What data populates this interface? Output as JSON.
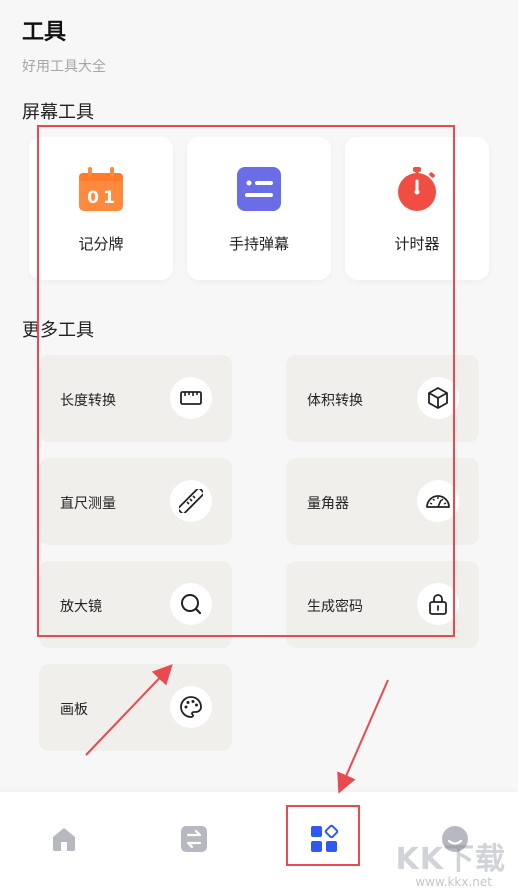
{
  "header": {
    "title": "工具",
    "subtitle": "好用工具大全"
  },
  "sections": {
    "screen_tools_title": "屏幕工具",
    "more_tools_title": "更多工具"
  },
  "screen_tools": [
    {
      "label": "记分牌",
      "icon": "scoreboard-icon",
      "color": "#ff8a3d"
    },
    {
      "label": "手持弹幕",
      "icon": "bullet-comment-icon",
      "color": "#6b6de6"
    },
    {
      "label": "计时器",
      "icon": "stopwatch-icon",
      "color": "#f04d43"
    }
  ],
  "more_tools": [
    {
      "label": "长度转换",
      "icon": "ruler-icon"
    },
    {
      "label": "体积转换",
      "icon": "cube-icon"
    },
    {
      "label": "直尺测量",
      "icon": "straight-ruler-icon"
    },
    {
      "label": "量角器",
      "icon": "protractor-icon"
    },
    {
      "label": "放大镜",
      "icon": "magnifier-icon"
    },
    {
      "label": "生成密码",
      "icon": "lock-icon"
    },
    {
      "label": "画板",
      "icon": "palette-icon"
    }
  ],
  "bottom_nav": [
    {
      "icon": "home-icon",
      "active": false
    },
    {
      "icon": "swap-icon",
      "active": false
    },
    {
      "icon": "tools-grid-icon",
      "active": true
    },
    {
      "icon": "profile-icon",
      "active": false
    }
  ],
  "colors": {
    "accent": "#2f59f2",
    "annotation_red": "#e84a4f",
    "nav_inactive": "#b8b8c0"
  },
  "watermark": {
    "text": "KK下载",
    "url": "www.kkx.net"
  }
}
